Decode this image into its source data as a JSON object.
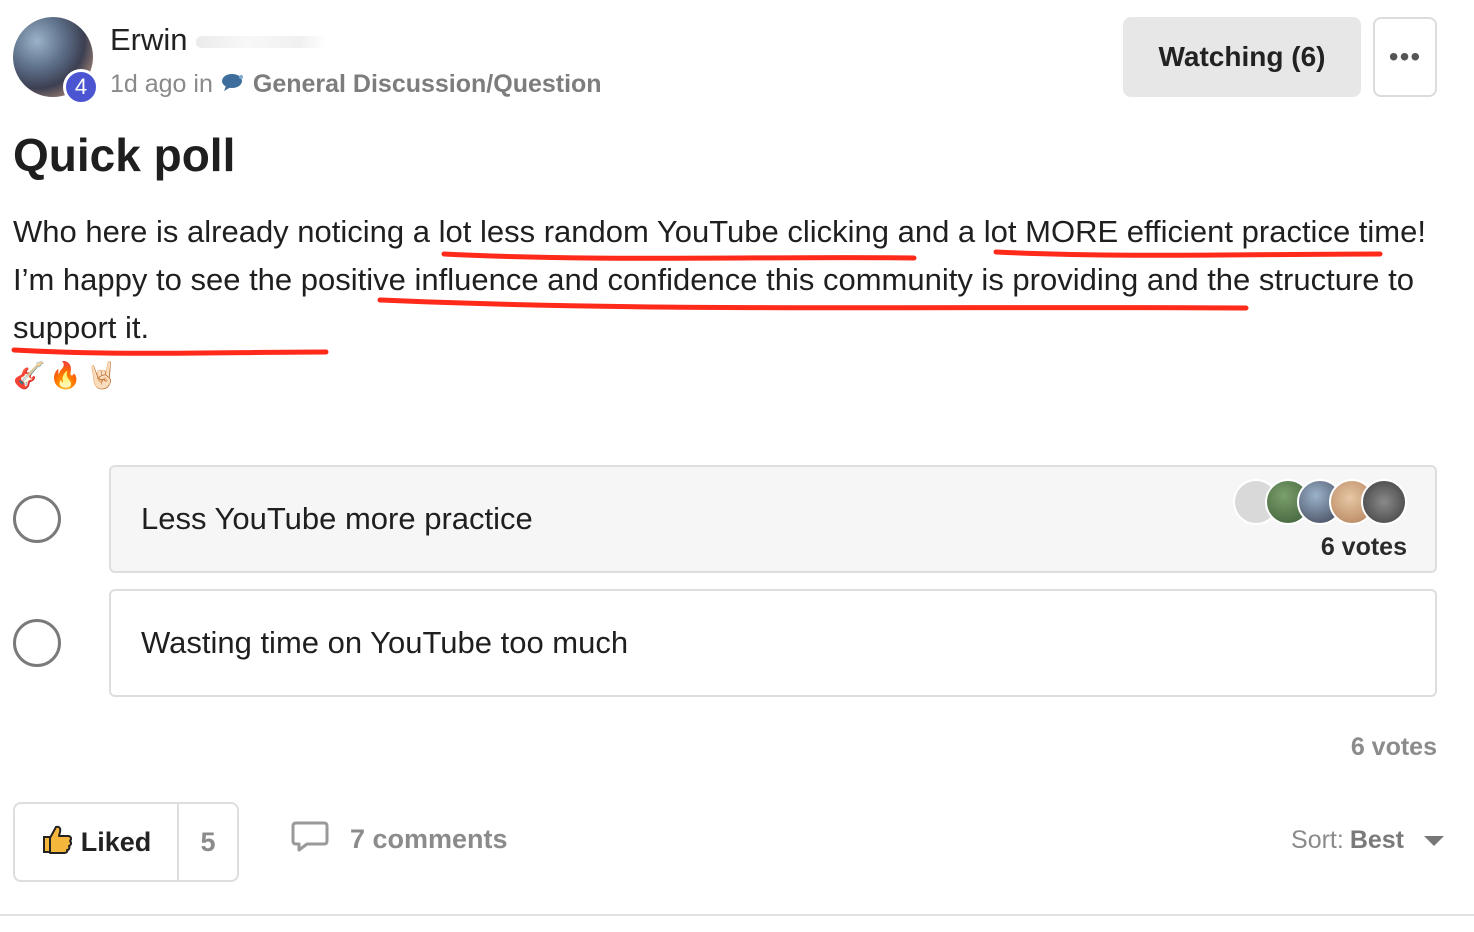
{
  "post": {
    "author": {
      "name": "Erwin",
      "level": "4"
    },
    "meta": {
      "time": "1d ago in",
      "category": "General Discussion/Question",
      "category_icon": "speech-bubble-icon"
    },
    "watching_label": "Watching (6)",
    "more_label": "•••",
    "title": "Quick poll",
    "body": {
      "s1": "Who here is already noticing a ",
      "s2": "lot less random YouTube clicking",
      "s3": " and a ",
      "s4": "lot MORE efficient practice",
      "s5": " time! I’m happy to see the ",
      "s6": "positive influence and confidence this community is providing",
      "s7": " and the ",
      "s8": "structure to support it.",
      "emojis": "🎸🔥🤘🏻"
    }
  },
  "poll": {
    "options": [
      {
        "label": "Less YouTube more practice",
        "votes_label": "6 votes",
        "selected": false
      },
      {
        "label": "Wasting time on YouTube too much",
        "selected": false
      }
    ],
    "total_votes_label": "6 votes"
  },
  "footer": {
    "like_label": "Liked",
    "like_count": "5",
    "comments_label": "7 comments",
    "sort_prefix": "Sort:",
    "sort_value": "Best"
  },
  "colors": {
    "accent": "#4b55d2",
    "annotation_red": "#ff2a1a"
  }
}
